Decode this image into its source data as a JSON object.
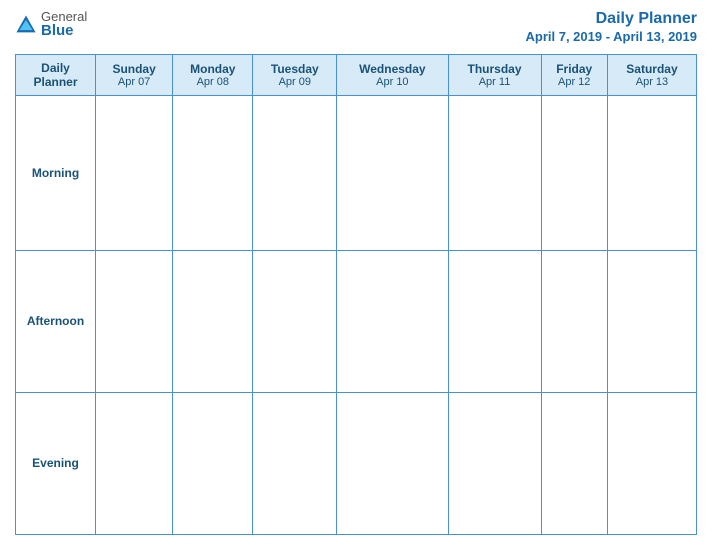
{
  "header": {
    "logo_general": "General",
    "logo_blue": "Blue",
    "title": "Daily Planner",
    "date_range": "April 7, 2019 - April 13, 2019"
  },
  "columns": [
    {
      "name": "Daily\nPlanner",
      "date": ""
    },
    {
      "name": "Sunday",
      "date": "Apr 07"
    },
    {
      "name": "Monday",
      "date": "Apr 08"
    },
    {
      "name": "Tuesday",
      "date": "Apr 09"
    },
    {
      "name": "Wednesday",
      "date": "Apr 10"
    },
    {
      "name": "Thursday",
      "date": "Apr 11"
    },
    {
      "name": "Friday",
      "date": "Apr 12"
    },
    {
      "name": "Saturday",
      "date": "Apr 13"
    }
  ],
  "rows": [
    {
      "label": "Morning"
    },
    {
      "label": "Afternoon"
    },
    {
      "label": "Evening"
    }
  ]
}
